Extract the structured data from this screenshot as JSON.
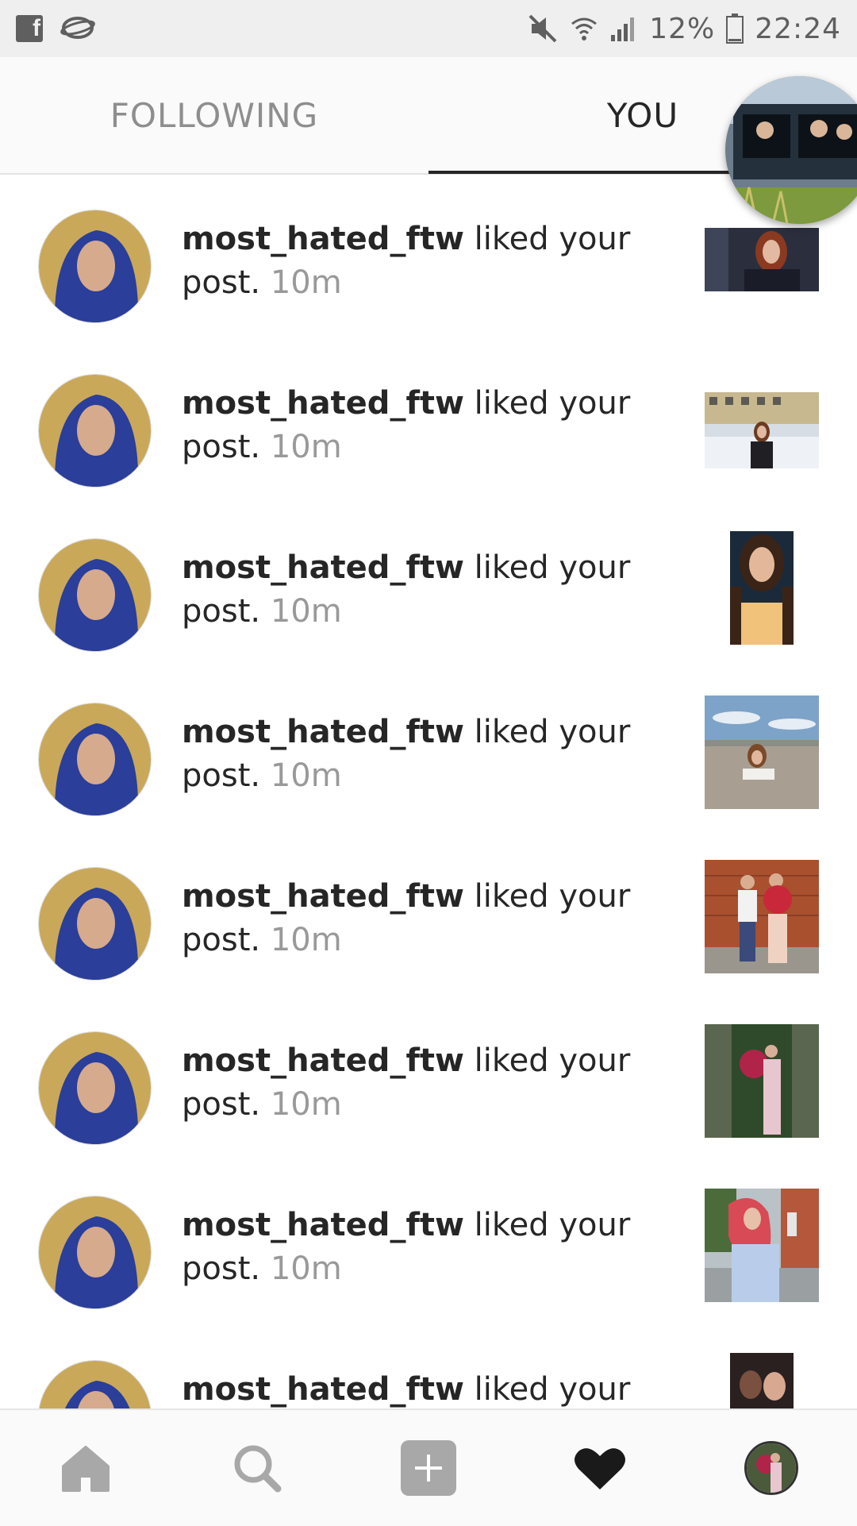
{
  "status_bar": {
    "battery": "12%",
    "time": "22:24",
    "icons": [
      "facebook-icon",
      "messenger-icon",
      "mute-icon",
      "wifi-icon",
      "signal-icon",
      "battery-icon"
    ]
  },
  "tabs": {
    "following": "FOLLOWING",
    "you": "YOU",
    "active": "you"
  },
  "notifications": [
    {
      "username": "most_hated_ftw",
      "action": " liked your post.",
      "time": " 10m"
    },
    {
      "username": "most_hated_ftw",
      "action": " liked your post.",
      "time": " 10m"
    },
    {
      "username": "most_hated_ftw",
      "action": " liked your post.",
      "time": " 10m"
    },
    {
      "username": "most_hated_ftw",
      "action": " liked your post.",
      "time": " 10m"
    },
    {
      "username": "most_hated_ftw",
      "action": " liked your post.",
      "time": " 10m"
    },
    {
      "username": "most_hated_ftw",
      "action": " liked your post.",
      "time": " 10m"
    },
    {
      "username": "most_hated_ftw",
      "action": " liked your post.",
      "time": " 10m"
    },
    {
      "username": "most_hated_ftw",
      "action": " liked your",
      "time": ""
    }
  ],
  "bottom_nav": [
    "home-icon",
    "search-icon",
    "add-post-icon",
    "heart-icon",
    "profile-avatar"
  ],
  "colors": {
    "text": "#262626",
    "secondary": "#8e8e8e",
    "background": "#ffffff",
    "bar": "#fafafa"
  }
}
